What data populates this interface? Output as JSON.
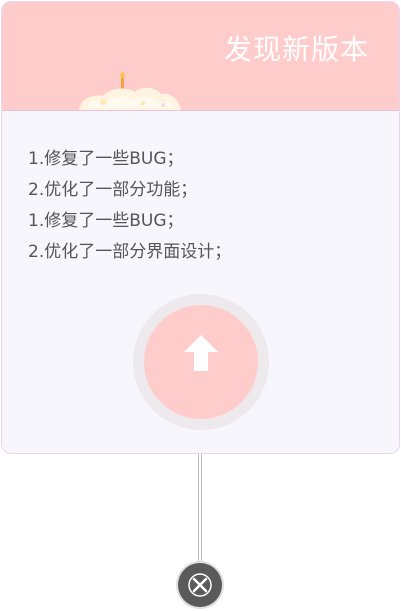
{
  "dialog": {
    "title": "发现新版本",
    "notes": [
      "1.修复了一些BUG；",
      "2.优化了一部分功能；",
      "1.修复了一些BUG；",
      "2.优化了一部分界面设计；"
    ],
    "update_icon": "arrow-up-icon",
    "close_icon": "close-icon",
    "decoration_icon": "cake-icon"
  },
  "colors": {
    "header_bg": "#ffcccc",
    "card_bg": "#f8f6fd",
    "button_ring": "#ede9ec",
    "button_fill": "#ffcccc",
    "close_bg": "#5a5a5a",
    "text": "#555555"
  }
}
